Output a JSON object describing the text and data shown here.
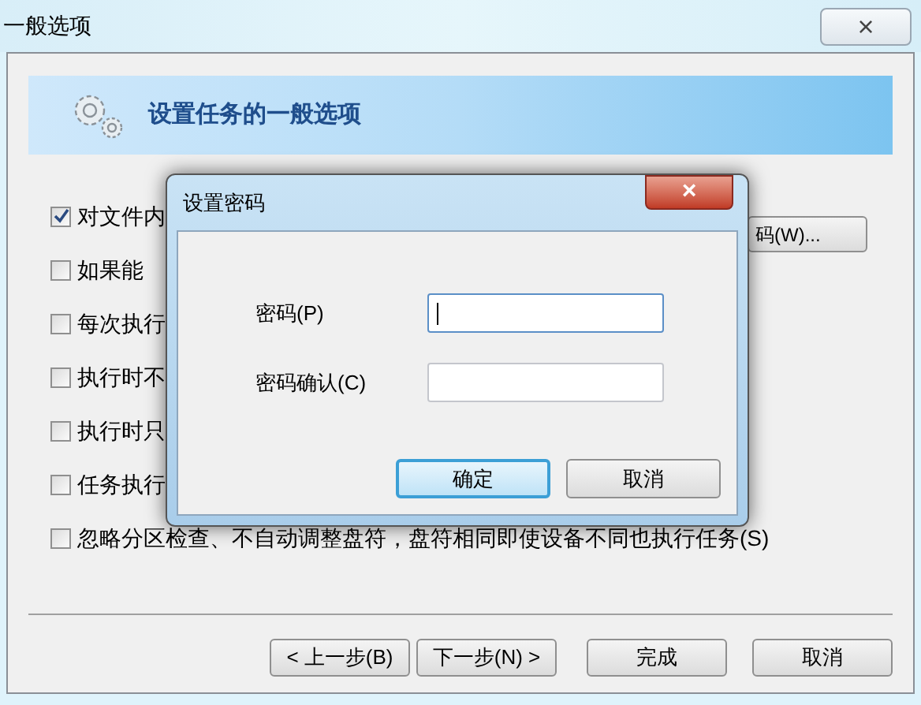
{
  "window": {
    "title": "一般选项",
    "close": "×"
  },
  "header": {
    "title": "设置任务的一般选项"
  },
  "options": [
    {
      "label": "对文件内",
      "checked": true
    },
    {
      "label": "如果能",
      "checked": false
    },
    {
      "label": "每次执行",
      "checked": false
    },
    {
      "label": "执行时不",
      "checked": false
    },
    {
      "label": "执行时只",
      "checked": false
    },
    {
      "label": "任务执行",
      "checked": false
    },
    {
      "label": "忽略分区检查、不自动调整盘符，盘符相同即使设备不同也执行任务(S)",
      "checked": false
    }
  ],
  "side_button": "码(W)...",
  "buttons": [
    "< 上一步(B)",
    "下一步(N) >",
    "完成",
    "取消"
  ],
  "dialog": {
    "title": "设置密码",
    "close": "×",
    "fields": [
      {
        "label": "密码(P)",
        "focused": true
      },
      {
        "label": "密码确认(C)",
        "focused": false
      }
    ],
    "buttons": [
      {
        "label": "确定",
        "default": true
      },
      {
        "label": "取消",
        "default": false
      }
    ]
  }
}
